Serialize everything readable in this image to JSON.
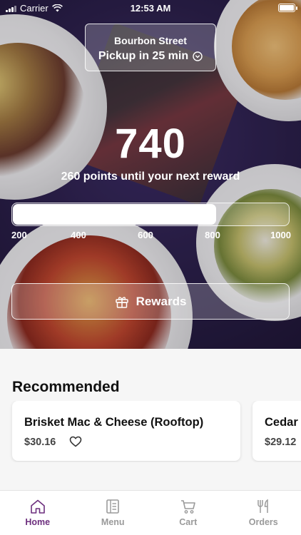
{
  "status_bar": {
    "carrier": "Carrier",
    "time": "12:53 AM"
  },
  "location": {
    "store": "Bourbon Street",
    "pickup": "Pickup in 25 min"
  },
  "rewards": {
    "points": "740",
    "message": "260 points until your next reward",
    "progress_value": 740,
    "scale_min": 200,
    "scale_max": 1000,
    "ticks": [
      "200",
      "400",
      "600",
      "800",
      "1000"
    ],
    "button_label": "Rewards"
  },
  "recommended": {
    "title": "Recommended",
    "items": [
      {
        "name": "Brisket Mac & Cheese (Rooftop)",
        "price": "$30.16"
      },
      {
        "name": "Cedar",
        "price": "$29.12"
      }
    ]
  },
  "tabs": [
    {
      "label": "Home",
      "icon": "home-icon",
      "active": true
    },
    {
      "label": "Menu",
      "icon": "menu-icon",
      "active": false
    },
    {
      "label": "Cart",
      "icon": "cart-icon",
      "active": false
    },
    {
      "label": "Orders",
      "icon": "fork-knife-icon",
      "active": false
    }
  ],
  "colors": {
    "accent": "#6d2f7e",
    "inactive": "#9a9a9a",
    "hero_base": "#2a1f48"
  }
}
